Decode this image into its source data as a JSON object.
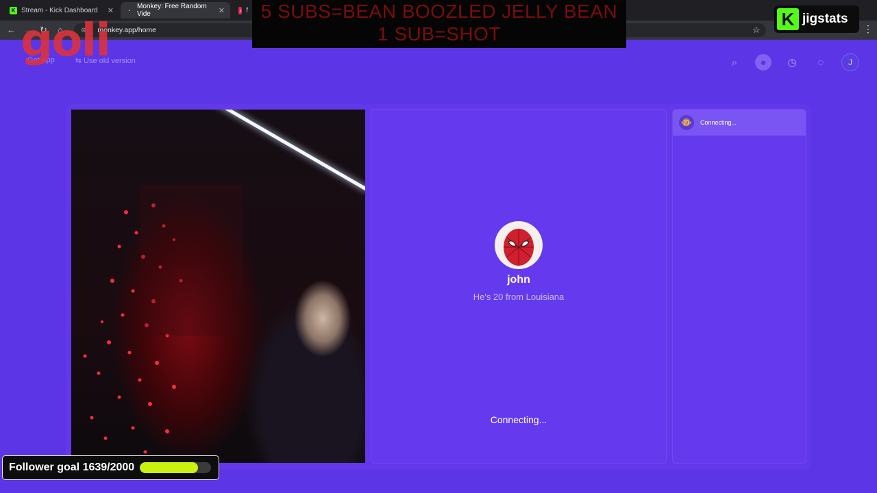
{
  "browser": {
    "tabs": [
      {
        "title": "Stream - Kick Dashboard",
        "favicon": "kick-icon"
      },
      {
        "title": "Monkey: Free Random Vide",
        "favicon": "monkey-icon"
      },
      {
        "title": "f",
        "favicon": "music-icon"
      }
    ],
    "url": "monkey.app/home"
  },
  "overlay": {
    "sub_banner_line1": "5 SUBS=BEAN BOOZLED JELLY BEAN",
    "sub_banner_line2": "1 SUB=SHOT",
    "logo": "goli",
    "jigstats_k": "K",
    "jigstats_label": "jigstats",
    "follower_goal": {
      "label": "Follower goal 1639/2000",
      "current": 1639,
      "target": 2000
    }
  },
  "site": {
    "get_app": "Get App",
    "old_version": "Use old version",
    "user_initial": "J"
  },
  "partner": {
    "name": "john",
    "info": "He's 20 from Louisiana",
    "status": "Connecting..."
  },
  "chat": {
    "status": "Connecting..."
  },
  "colors": {
    "background": "#5b35e6",
    "panel": "#6539ee",
    "goal_fill": "#c9f30f",
    "kick_green": "#53fc18"
  }
}
